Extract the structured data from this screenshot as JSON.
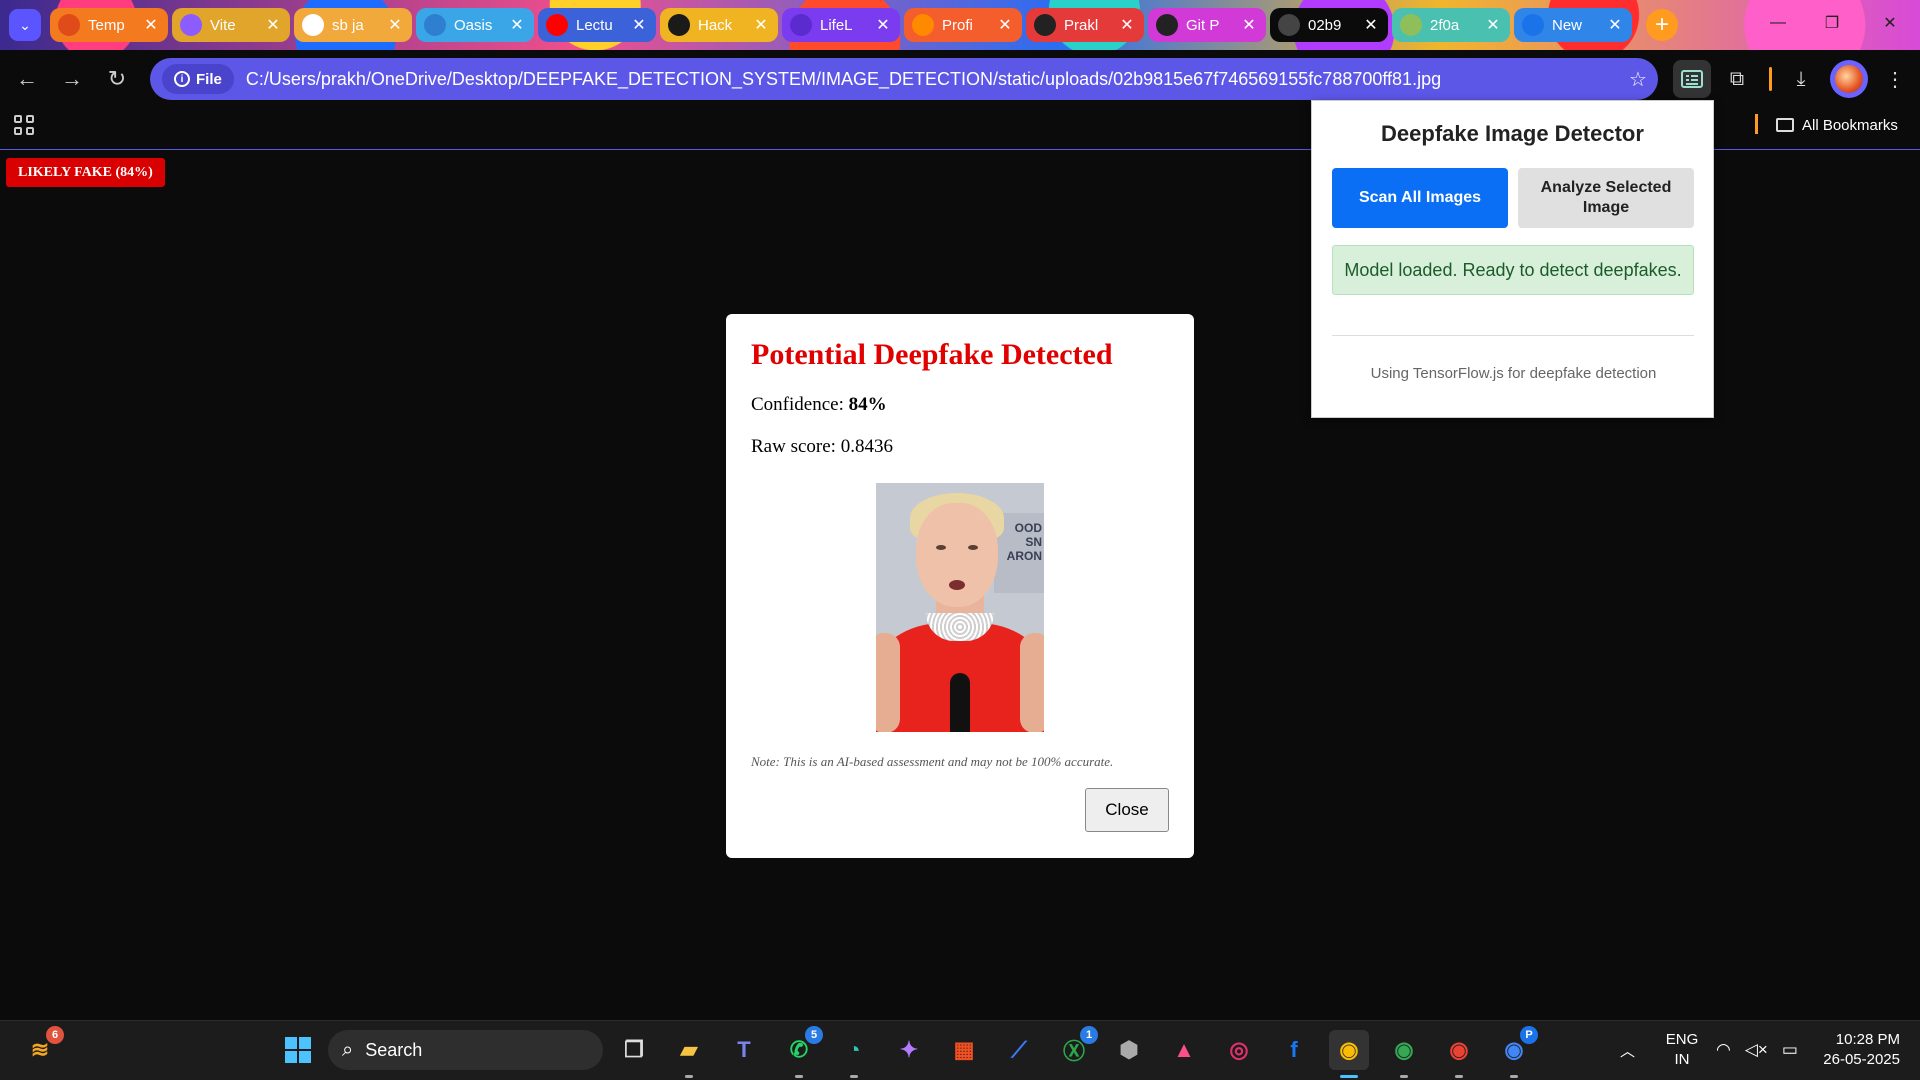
{
  "tabs": [
    {
      "title": "Temp",
      "favicon": "template-icon",
      "bg": "#f47a1f",
      "fav_bg": "#e04b1a"
    },
    {
      "title": "Vite",
      "favicon": "vite-icon",
      "bg": "#e0a52a",
      "fav_bg": "#8d5cff"
    },
    {
      "title": "sb ja",
      "favicon": "google-icon",
      "bg": "#f2a93b",
      "fav_bg": "#ffffff"
    },
    {
      "title": "Oasis",
      "favicon": "oasis-icon",
      "bg": "#3aa6e8",
      "fav_bg": "#2f7fd0"
    },
    {
      "title": "Lectu",
      "favicon": "youtube-icon",
      "bg": "#3b62d8",
      "fav_bg": "#ff0000"
    },
    {
      "title": "Hack",
      "favicon": "heart-icon",
      "bg": "#f0b321",
      "fav_bg": "#1a1a1a"
    },
    {
      "title": "LifeL",
      "favicon": "list-icon",
      "bg": "#7b3cf0",
      "fav_bg": "#5b2bd0"
    },
    {
      "title": "Profi",
      "favicon": "firefox-icon",
      "bg": "#f45d2c",
      "fav_bg": "#ff8a00"
    },
    {
      "title": "Prakl",
      "favicon": "github-icon",
      "bg": "#e53a3a",
      "fav_bg": "#222222"
    },
    {
      "title": "Git P",
      "favicon": "openai-icon",
      "bg": "#d13ad6",
      "fav_bg": "#222222"
    },
    {
      "title": "02b9",
      "favicon": "globe-icon",
      "active": true,
      "bg": "#0b0b0b",
      "fav_bg": "#444444"
    },
    {
      "title": "2f0a",
      "favicon": "globe-icon",
      "bg": "#49c0b0",
      "fav_bg": "#8fbf5a"
    },
    {
      "title": "New",
      "favicon": "chrome-icon",
      "bg": "#2f86e8",
      "fav_bg": "#1a73e8"
    }
  ],
  "toolbar": {
    "file_label": "File",
    "url": "C:/Users/prakh/OneDrive/Desktop/DEEPFAKE_DETECTION_SYSTEM/IMAGE_DETECTION/static/uploads/02b9815e67f746569155fc788700ff81.jpg"
  },
  "bookmarks": {
    "all_label": "All Bookmarks"
  },
  "page": {
    "badge": "LIKELY FAKE (84%)"
  },
  "modal": {
    "title": "Potential Deepfake Detected",
    "confidence_label": "Confidence: ",
    "confidence_value": "84%",
    "raw_label": "Raw score: ",
    "raw_value": "0.8436",
    "sign_text": "OOD\nSN\nARON",
    "note": "Note: This is an AI-based assessment and may not be 100% accurate.",
    "close_label": "Close"
  },
  "popup": {
    "title": "Deepfake Image Detector",
    "scan_all_label": "Scan All Images",
    "analyze_label": "Analyze Selected Image",
    "status": "Model loaded. Ready to detect deepfakes.",
    "footer": "Using TensorFlow.js for deepfake detection"
  },
  "taskbar": {
    "search_label": "Search",
    "widgets_badge": "6",
    "whatsapp_badge": "5",
    "xbox_badge": "1",
    "chrome_profile_badge": "P",
    "lang_line1": "ENG",
    "lang_line2": "IN",
    "time": "10:28 PM",
    "date": "26-05-2025"
  }
}
